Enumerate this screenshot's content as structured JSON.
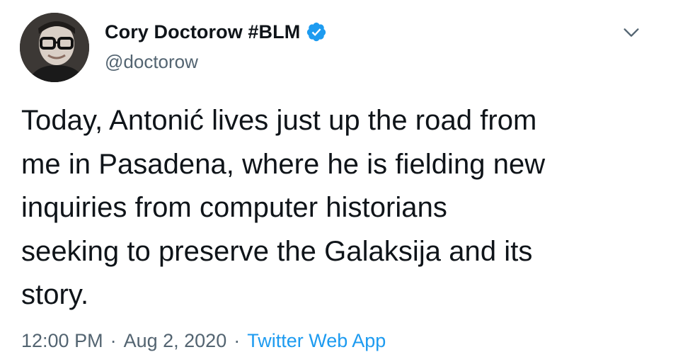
{
  "author": {
    "display_name": "Cory Doctorow #BLM",
    "handle": "@doctorow",
    "verified": true,
    "avatar_icon": "person-with-glasses-avatar"
  },
  "tweet": {
    "text": "Today, Antonić lives just up the road from\nme in Pasadena, where he is fielding new\ninquiries from computer historians\nseeking to preserve the Galaksija and its\nstory."
  },
  "meta": {
    "time": "12:00 PM",
    "separator": "·",
    "date": "Aug 2, 2020",
    "source": "Twitter Web App"
  },
  "icons": {
    "more": "chevron-down-icon",
    "verified": "verified-badge-icon"
  },
  "colors": {
    "text": "#0f1419",
    "secondary": "#536471",
    "accent": "#1d9bf0"
  }
}
